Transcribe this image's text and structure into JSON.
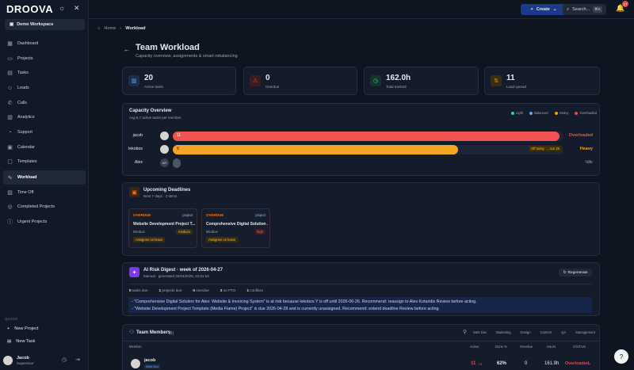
{
  "brand": {
    "logo": "DROOVA"
  },
  "workspace": {
    "name": "Demo Workspace"
  },
  "nav": [
    {
      "label": "Dashboard",
      "icon": "grid-icon"
    },
    {
      "label": "Projects",
      "icon": "folder-icon"
    },
    {
      "label": "Tasks",
      "icon": "doc-icon"
    },
    {
      "label": "Leads",
      "icon": "person-icon"
    },
    {
      "label": "Calls",
      "icon": "phone-icon"
    },
    {
      "label": "Analytics",
      "icon": "chart-icon"
    },
    {
      "label": "Support",
      "icon": "support-icon"
    },
    {
      "label": "Calendar",
      "icon": "calendar-icon"
    },
    {
      "label": "Templates",
      "icon": "template-icon"
    },
    {
      "label": "Workload",
      "icon": "pulse-icon"
    },
    {
      "label": "Time Off",
      "icon": "timeoff-icon"
    },
    {
      "label": "Completed Projects",
      "icon": "check-icon"
    },
    {
      "label": "Urgent Projects",
      "icon": "alert-icon"
    }
  ],
  "quick": {
    "label": "QUICK",
    "new_project": "New Project",
    "new_task": "New Task"
  },
  "user": {
    "name": "Jacob",
    "role": "Supervisor"
  },
  "topbar": {
    "create": "Create",
    "search": "Search...",
    "shortcut": "⌘K",
    "notif_count": "17"
  },
  "breadcrumb": {
    "home": "Home",
    "current": "Workload"
  },
  "page": {
    "title": "Team Workload",
    "subtitle": "Capacity overview, assignments & smart rebalancing"
  },
  "stats": [
    {
      "value": "20",
      "label": "Active tasks",
      "color": "#60a5fa"
    },
    {
      "value": "0",
      "label": "Overdue",
      "color": "#ef4444"
    },
    {
      "value": "162.0h",
      "label": "Total tracked",
      "color": "#34d399"
    },
    {
      "value": "11",
      "label": "Load spread",
      "color": "#f59e0b"
    }
  ],
  "capacity": {
    "title": "Capacity Overview",
    "subtitle": "Avg 6.7 active tasks per member",
    "legend": [
      {
        "label": "Light",
        "color": "#34d399"
      },
      {
        "label": "Balanced",
        "color": "#60a5fa"
      },
      {
        "label": "Heavy",
        "color": "#f59e0b"
      },
      {
        "label": "Overloaded",
        "color": "#ef4444"
      }
    ],
    "rows": [
      {
        "name": "jacob",
        "count": "11",
        "fill": 0.99,
        "color": "#ef5350",
        "status": "Overloaded",
        "status_color": "#ef5350",
        "note": ""
      },
      {
        "name": "lekobos",
        "count": "9",
        "fill": 0.73,
        "color": "#f5a524",
        "status": "Heavy",
        "status_color": "#f5a524",
        "note": "Off today → Jun 26"
      },
      {
        "name": "Alex",
        "count": "",
        "fill": 0.02,
        "color": "#4b5563",
        "status": "Idle",
        "status_color": "#9ca3af",
        "note": "",
        "avatar_text": "AR"
      }
    ]
  },
  "deadlines": {
    "title": "Upcoming Deadlines",
    "subtitle": "Next 7 days · 2 items",
    "items": [
      {
        "tag": "OVERDUE",
        "type": "project",
        "title": "Website Development Project T...",
        "owner": "lekobos",
        "priority": "medium",
        "priority_color": "#fbbf24",
        "assign": "Assignee on leave"
      },
      {
        "tag": "OVERDUE",
        "type": "project",
        "title": "Comprehensive Digital Solution ...",
        "owner": "lekobos",
        "priority": "high",
        "priority_color": "#f87171",
        "assign": "Assignee on leave"
      }
    ]
  },
  "digest": {
    "title": "AI Risk Digest · week of 2026-04-27",
    "subtitle": "Manual · generated 26/04/2026, 21:01:53",
    "regen": "Regenerate",
    "summary": [
      {
        "n": "0",
        "t": "tasks due"
      },
      {
        "n": "1",
        "t": "projects due"
      },
      {
        "n": "0",
        "t": "overdue"
      },
      {
        "n": "2",
        "t": "on PTO"
      },
      {
        "n": "1",
        "t": "conflicts"
      }
    ],
    "lines": [
      "- \"Comprehensive Digital Solution for Alex: Website & Invoicing System\" is at risk because lekobos Y is off until 2026-06-26. Recommend: reassign to Alex Kotaridis Review before acting.",
      "- \"Website Development Project Template (Media Flame) Project\" is due 2026-04-28 and is currently unassigned. Recommend: extend deadline Review before acting."
    ]
  },
  "team": {
    "title": "Team Members",
    "count": "(3)",
    "filters": [
      "Web Dev",
      "Marketing",
      "Design",
      "Content",
      "QA",
      "Management"
    ],
    "columns": [
      "Member",
      "Active",
      "Done %",
      "Overdue",
      "Hours",
      "STATUS"
    ],
    "rows": [
      {
        "name": "jacob",
        "role": "Web Dev",
        "active": "11",
        "delta": "+4",
        "done": "62%",
        "overdue": "0",
        "hours": "161.9h",
        "status": "Overloaded"
      }
    ]
  }
}
